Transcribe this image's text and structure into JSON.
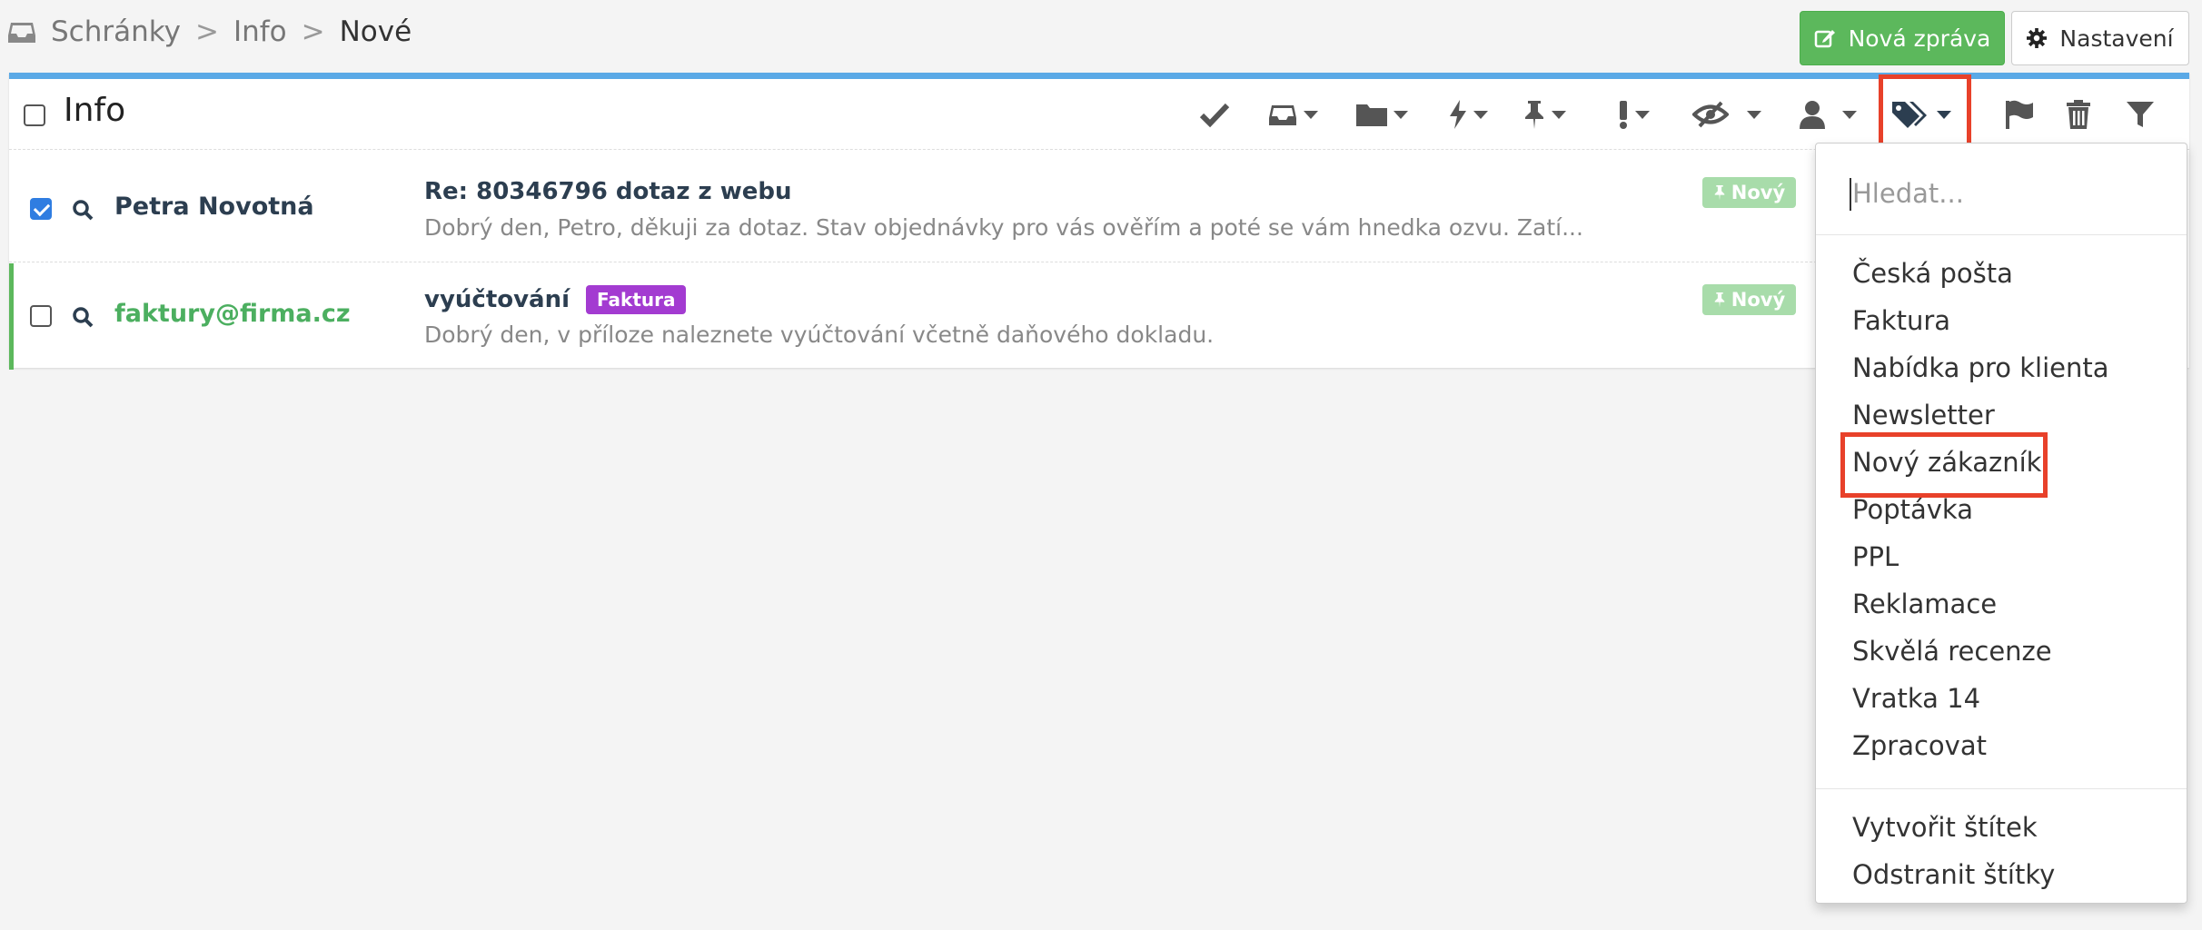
{
  "breadcrumb": {
    "items": [
      "Schránky",
      "Info",
      "Nové"
    ],
    "separator": ">"
  },
  "actions": {
    "new_message": "Nová zpráva",
    "settings": "Nastavení"
  },
  "panel": {
    "title": "Info",
    "accent_color": "#5aa9e6",
    "toolbar_icons": [
      "check-icon",
      "inbox-icon",
      "folder-icon",
      "bolt-icon",
      "pin-icon",
      "exclamation-icon",
      "eye-slash-icon",
      "user-icon",
      "tags-icon",
      "flag-icon",
      "trash-icon",
      "filter-icon"
    ]
  },
  "messages": [
    {
      "checked": true,
      "sender": "Petra Novotná",
      "subject": "Re: 80346796 dotaz z webu",
      "preview": "Dobrý den, Petro,  děkuji za dotaz.  Stav objednávky pro vás ověřím a poté se vám hnedka ozvu.  Zatí...",
      "status": "Nový"
    },
    {
      "checked": false,
      "sender": "faktury@firma.cz",
      "subject": "vyúčtování",
      "label": "Faktura",
      "label_color": "#a33bd1",
      "preview": "Dobrý den, v příloze naleznete vyúčtování včetně daňového dokladu.",
      "status": "Nový"
    }
  ],
  "tags_dropdown": {
    "search_placeholder": "Hledat...",
    "tags": [
      "Česká pošta",
      "Faktura",
      "Nabídka pro klienta",
      "Newsletter",
      "Nový zákazník",
      "Poptávka",
      "PPL",
      "Reklamace",
      "Skvělá recenze",
      "Vratka 14",
      "Zpracovat"
    ],
    "highlighted_tag": "Nový zákazník",
    "create_label": "Vytvořit štítek",
    "remove_label": "Odstranit štítky"
  },
  "colors": {
    "primary_button": "#5cb85c",
    "highlight": "#e8412a",
    "unread_accent": "#5cb85c"
  }
}
